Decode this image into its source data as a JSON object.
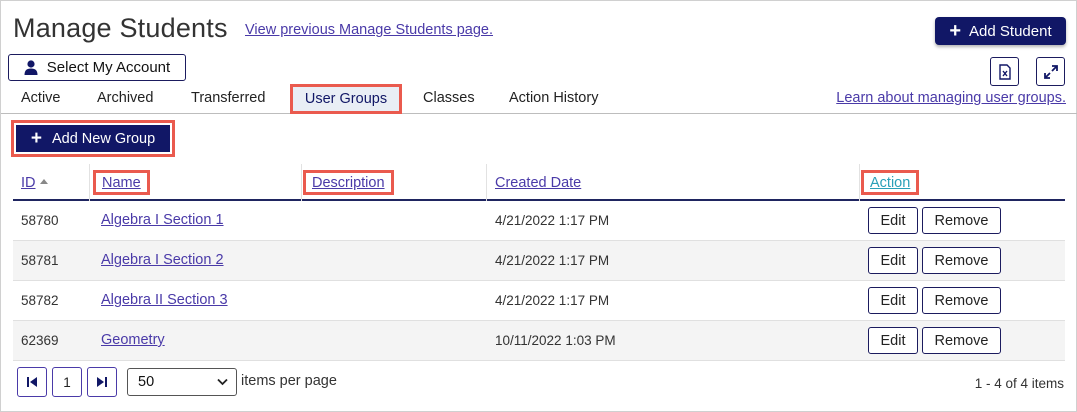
{
  "header": {
    "title": "Manage Students",
    "prev_link": "View previous Manage Students page.",
    "add_student": "Add Student",
    "select_account": "Select My Account"
  },
  "tabs": [
    {
      "label": "Active",
      "active": false
    },
    {
      "label": "Archived",
      "active": false
    },
    {
      "label": "Transferred",
      "active": false
    },
    {
      "label": "User Groups",
      "active": true
    },
    {
      "label": "Classes",
      "active": false
    },
    {
      "label": "Action History",
      "active": false
    }
  ],
  "learn_link": "Learn about managing user groups.",
  "add_group": "Add New Group",
  "table": {
    "headers": {
      "id": "ID",
      "name": "Name",
      "description": "Description",
      "created": "Created Date",
      "action": "Action"
    },
    "edit_label": "Edit",
    "remove_label": "Remove",
    "rows": [
      {
        "id": "58780",
        "name": "Algebra I Section 1",
        "description": "",
        "created": "4/21/2022 1:17 PM"
      },
      {
        "id": "58781",
        "name": "Algebra I Section 2",
        "description": "",
        "created": "4/21/2022 1:17 PM"
      },
      {
        "id": "58782",
        "name": "Algebra II Section 3",
        "description": "",
        "created": "4/21/2022 1:17 PM"
      },
      {
        "id": "62369",
        "name": "Geometry",
        "description": "",
        "created": "10/11/2022 1:03 PM"
      }
    ]
  },
  "pager": {
    "page": "1",
    "per_page": "50",
    "per_page_label": "items per page",
    "count": "1 - 4 of 4 items"
  },
  "colors": {
    "navy": "#111766",
    "highlight": "#ea5a4e",
    "link": "#4a3aa8"
  },
  "icons": [
    "plus-icon",
    "user-icon",
    "excel-export-icon",
    "expand-icon",
    "first-page-icon",
    "last-page-icon",
    "chevron-down-icon",
    "sort-asc-icon"
  ]
}
